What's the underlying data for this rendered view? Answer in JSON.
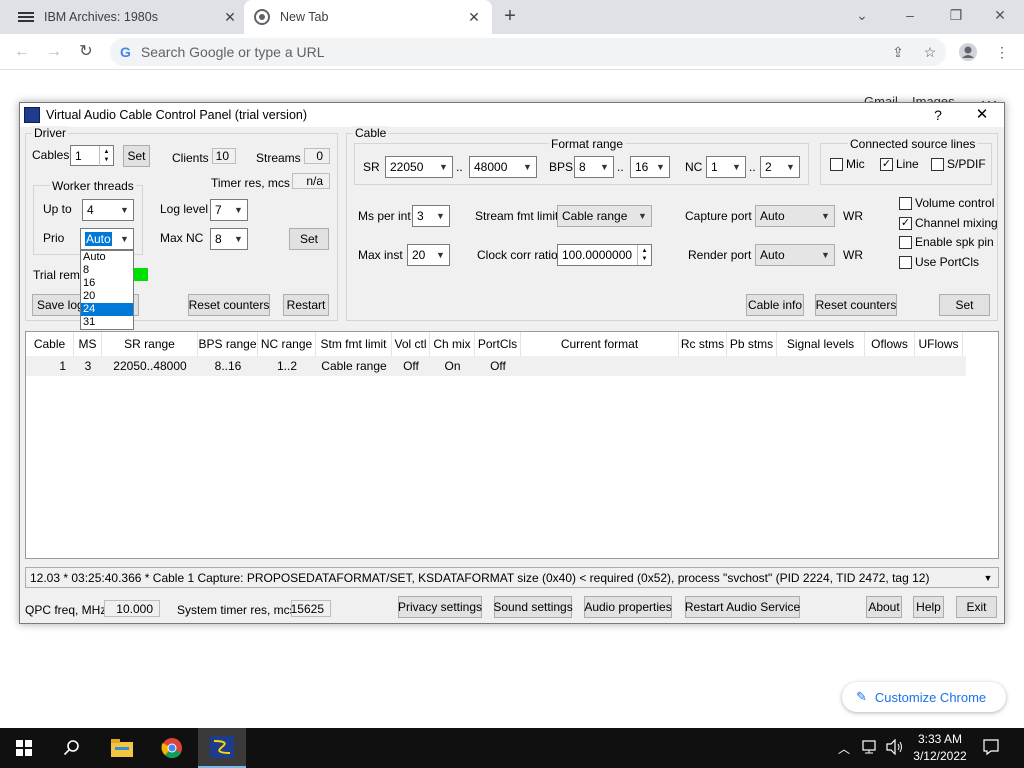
{
  "browser": {
    "tabs": [
      {
        "title": "IBM Archives: 1980s",
        "active": false
      },
      {
        "title": "New Tab",
        "active": true
      }
    ],
    "omnibox_placeholder": "Search Google or type a URL",
    "background_links": {
      "gmail": "Gmail",
      "images": "Images"
    },
    "customize_label": "Customize Chrome"
  },
  "vac": {
    "title": "Virtual Audio Cable Control Panel (trial version)",
    "help_label": "?",
    "driver": {
      "group_label": "Driver",
      "cables_label": "Cables",
      "cables_value": "1",
      "set_label": "Set",
      "clients_label": "Clients",
      "clients_value": "10",
      "streams_label": "Streams",
      "streams_value": "0",
      "timer_res_label": "Timer res, mcs",
      "timer_res_value": "n/a",
      "worker_threads_label": "Worker threads",
      "upto_label": "Up to",
      "upto_value": "4",
      "prio_label": "Prio",
      "prio_value": "Auto",
      "prio_options": [
        "Auto",
        "8",
        "16",
        "20",
        "24",
        "31"
      ],
      "prio_highlight": "24",
      "log_level_label": "Log level",
      "log_level_value": "7",
      "max_nc_label": "Max NC",
      "max_nc_value": "8",
      "set2_label": "Set",
      "trial_label": "Trial remi",
      "save_log_label": "Save log",
      "save_log_tail": "g",
      "reset_counters_label": "Reset counters",
      "restart_label": "Restart"
    },
    "cable": {
      "group_label": "Cable",
      "format_range_label": "Format range",
      "sr_label": "SR",
      "sr_min": "22050",
      "sr_max": "48000",
      "dots": "..",
      "bps_label": "BPS",
      "bps_min": "8",
      "bps_max": "16",
      "nc_label": "NC",
      "nc_min": "1",
      "nc_max": "2",
      "connected_label": "Connected source lines",
      "mic_label": "Mic",
      "line_label": "Line",
      "spdif_label": "S/PDIF",
      "ms_per_int_label": "Ms per int",
      "ms_per_int_value": "3",
      "stream_fmt_label": "Stream fmt limit",
      "stream_fmt_value": "Cable range",
      "capture_port_label": "Capture port",
      "capture_port_value": "Auto",
      "render_port_label": "Render port",
      "render_port_value": "Auto",
      "wr_label": "WR",
      "max_inst_label": "Max inst",
      "max_inst_value": "20",
      "clock_corr_label": "Clock corr ratio",
      "clock_corr_value": "100.0000000",
      "volume_control_label": "Volume control",
      "channel_mixing_label": "Channel mixing",
      "enable_spk_label": "Enable spk pin",
      "use_portcls_label": "Use PortCls",
      "cable_info_label": "Cable info",
      "reset_counters_label": "Reset counters",
      "set_label": "Set"
    },
    "table": {
      "headers": [
        "Cable",
        "MS",
        "SR range",
        "BPS range",
        "NC range",
        "Stm fmt limit",
        "Vol ctl",
        "Ch mix",
        "PortCls",
        "Current format",
        "Rc stms",
        "Pb stms",
        "Signal levels",
        "Oflows",
        "UFlows"
      ],
      "rows": [
        [
          "1",
          "3",
          "22050..48000",
          "8..16",
          "1..2",
          "Cable range",
          "Off",
          "On",
          "Off",
          "",
          "",
          "",
          "",
          "",
          ""
        ]
      ]
    },
    "log_message": "12.03 * 03:25:40.366 * Cable 1 Capture: PROPOSEDATAFORMAT/SET, KSDATAFORMAT size (0x40) < required (0x52), process \"svchost\" (PID 2224, TID 2472, tag 12)",
    "bottom": {
      "qpc_label": "QPC freq, MHz",
      "qpc_value": "10.000",
      "sys_timer_label": "System timer res, mcs",
      "sys_timer_value": "15625",
      "privacy_label": "Privacy settings",
      "sound_label": "Sound settings",
      "audio_props_label": "Audio properties",
      "restart_audio_label": "Restart Audio Service",
      "about_label": "About",
      "help_label": "Help",
      "exit_label": "Exit"
    }
  },
  "taskbar": {
    "time": "3:33 AM",
    "date": "3/12/2022"
  },
  "icons": [
    "windows-start-icon",
    "search-icon",
    "file-explorer-icon",
    "chrome-icon",
    "vac-app-icon",
    "tray-chevron-icon",
    "network-icon",
    "volume-icon",
    "notification-icon"
  ]
}
